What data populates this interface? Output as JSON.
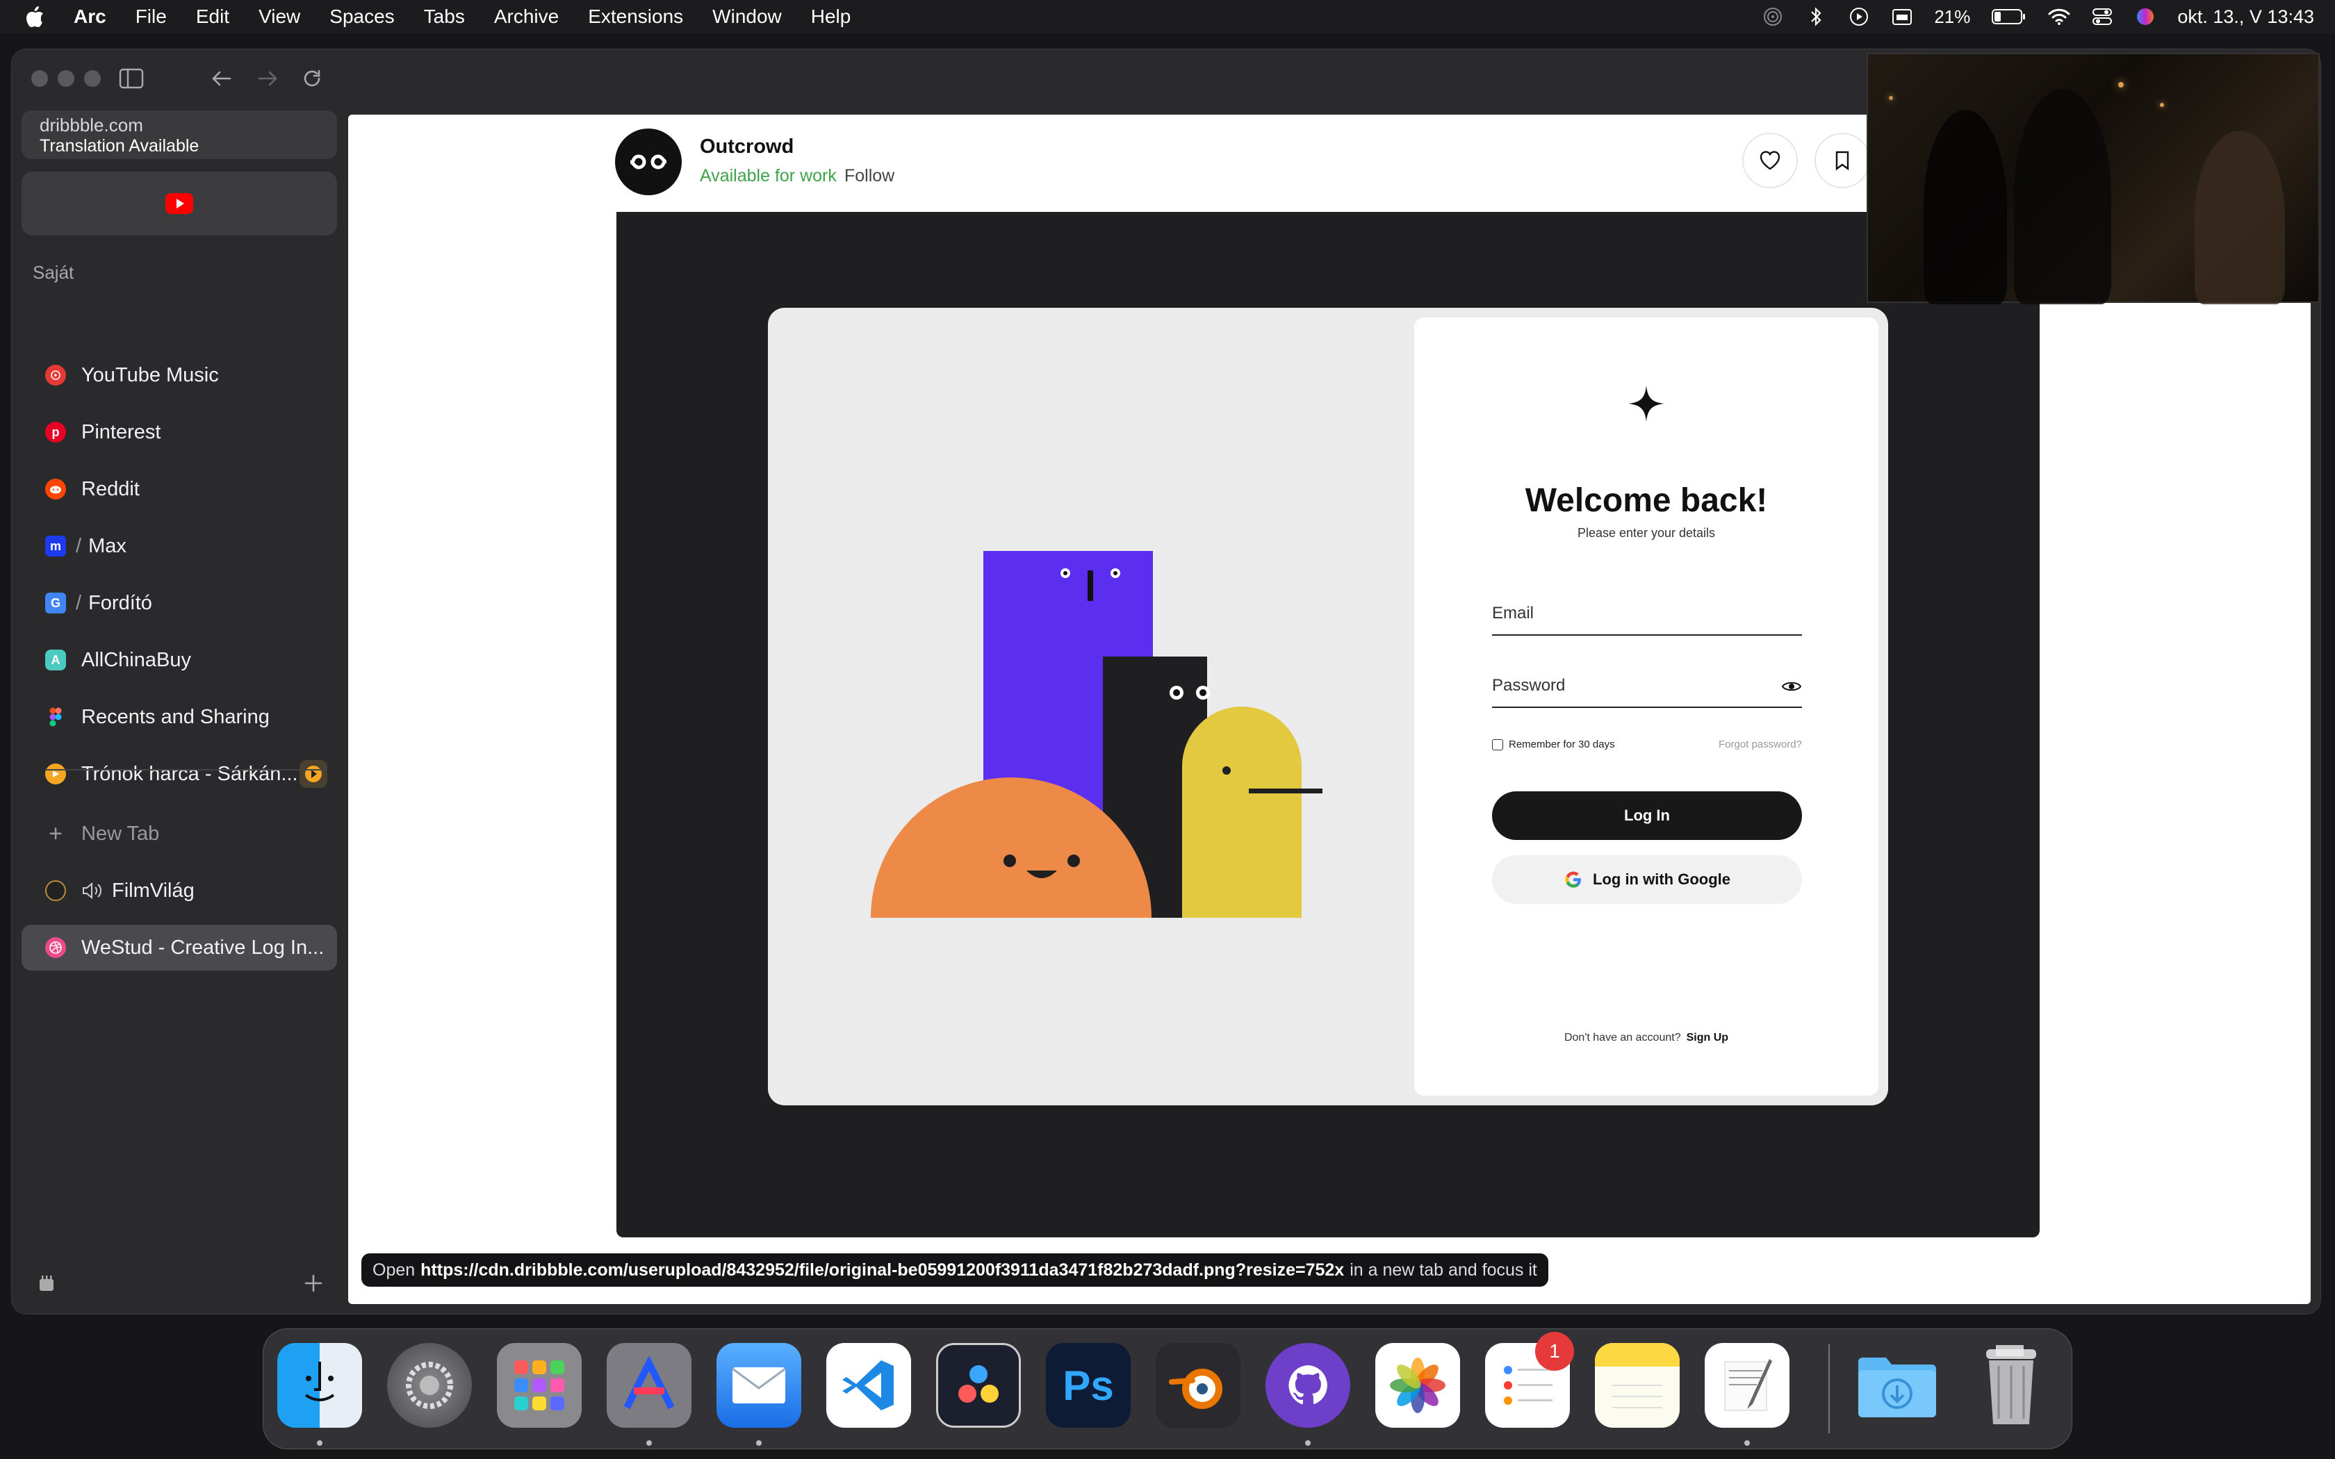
{
  "menubar": {
    "app": "Arc",
    "items": [
      "File",
      "Edit",
      "View",
      "Spaces",
      "Tabs",
      "Archive",
      "Extensions",
      "Window",
      "Help"
    ],
    "battery": "21%",
    "datetime": "okt. 13., V  13:43"
  },
  "sidebar": {
    "url_domain": "dribbble.com",
    "url_note": "Translation Available",
    "section_label": "Saját",
    "items": [
      {
        "label": "YouTube Music",
        "icon": "youtube-music-icon",
        "color": "#e53935"
      },
      {
        "label": "Pinterest",
        "icon": "pinterest-icon",
        "color": "#e60023"
      },
      {
        "label": "Reddit",
        "icon": "reddit-icon",
        "color": "#ff4500"
      },
      {
        "label": "Max",
        "icon": "max-icon",
        "color": "#1e3aee"
      },
      {
        "label": "Fordító",
        "icon": "translate-icon",
        "color": "#4285f4"
      },
      {
        "label": "AllChinaBuy",
        "icon": "allchinabuy-icon",
        "color": "#4cc9c0"
      },
      {
        "label": "Recents and Sharing",
        "icon": "figma-icon",
        "color": "#f24e1e"
      },
      {
        "label": "Trónok harca - Sárkán...",
        "icon": "play-icon",
        "color": "#f5a623"
      }
    ],
    "new_tab": "New Tab",
    "tabs": [
      {
        "label": "FilmVilág",
        "icon": "filmvilag-icon"
      },
      {
        "label": "WeStud - Creative Log In...",
        "icon": "dribbble-icon"
      }
    ]
  },
  "shot": {
    "author": "Outcrowd",
    "availability": "Available for work",
    "follow": "Follow"
  },
  "login": {
    "title": "Welcome back!",
    "subtitle": "Please enter your details",
    "email_label": "Email",
    "password_label": "Password",
    "remember": "Remember for 30 days",
    "forgot": "Forgot password?",
    "login_button": "Log In",
    "google_button": "Log in with Google",
    "no_account": "Don't have an account?",
    "sign_up": "Sign Up"
  },
  "status": {
    "prefix": "Open",
    "url": "https://cdn.dribbble.com/userupload/8432952/file/original-be05991200f3911da3471f82b273dadf.png?resize=752x",
    "suffix": "in a new tab and focus it"
  },
  "dock": {
    "apps": [
      "Finder",
      "System Settings",
      "Launchpad",
      "Affinity",
      "Mail",
      "Visual Studio Code",
      "DaVinci Resolve",
      "Photoshop",
      "Blender",
      "GitHub Desktop",
      "Photos",
      "Reminders",
      "Notes",
      "TextEdit",
      "Downloads",
      "Trash"
    ],
    "reminders_badge": "1",
    "ps_label": "Ps"
  },
  "colors": {
    "accent_green": "#3ea34a",
    "illustration_purple": "#5b2ef0",
    "illustration_orange": "#ee8a48",
    "illustration_yellow": "#e2c940",
    "illustration_black": "#1f1f22"
  }
}
